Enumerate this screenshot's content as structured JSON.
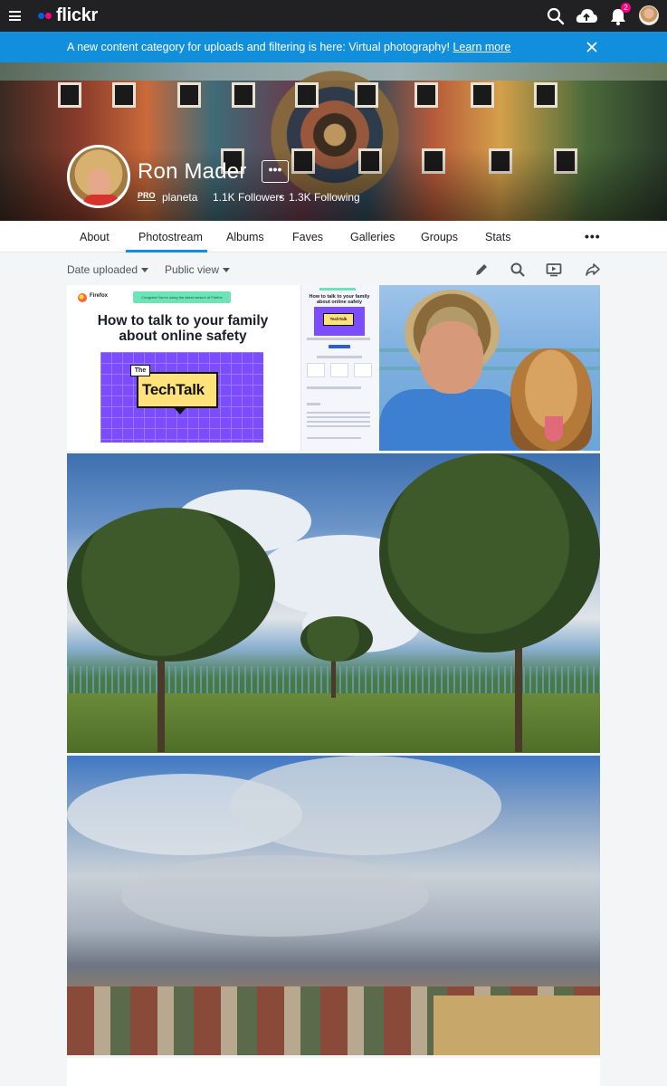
{
  "topbar": {
    "logo_text": "flickr",
    "notification_count": "2",
    "icons": [
      "hamburger-icon",
      "search-icon",
      "upload-cloud-icon",
      "bell-icon",
      "user-avatar"
    ]
  },
  "announcement": {
    "text": "A new content category for uploads and filtering is here: Virtual photography!",
    "link": "Learn more"
  },
  "profile": {
    "name": "Ron Mader",
    "more_label": "•••",
    "pro_badge": "PRO",
    "username": "planeta",
    "followers": "1.1K Followers",
    "separator": "•",
    "following": "1.3K Following"
  },
  "tabs": [
    "About",
    "Photostream",
    "Albums",
    "Faves",
    "Galleries",
    "Groups",
    "Stats"
  ],
  "active_tab": "Photostream",
  "subnav_more": "•••",
  "toolbar": {
    "sort_label": "Date uploaded",
    "view_label": "Public view",
    "icons": [
      "edit-icon",
      "search-icon",
      "slideshow-icon",
      "share-icon"
    ]
  },
  "photo1": {
    "browser_name": "Firefox",
    "banner": "Congrats! You're using the latest version of Firefox",
    "headline": "How to talk to your family about online safety",
    "badge_the": "The",
    "badge_word": "TechTalk",
    "side_title": "How to talk to your family about online safety",
    "side_mini": "TechTalk"
  },
  "colors": {
    "topbar": "#212124",
    "announcement": "#128fdc",
    "accent_blue": "#0063dc",
    "accent_pink": "#ff0084",
    "tab_underline": "#128fdc"
  }
}
